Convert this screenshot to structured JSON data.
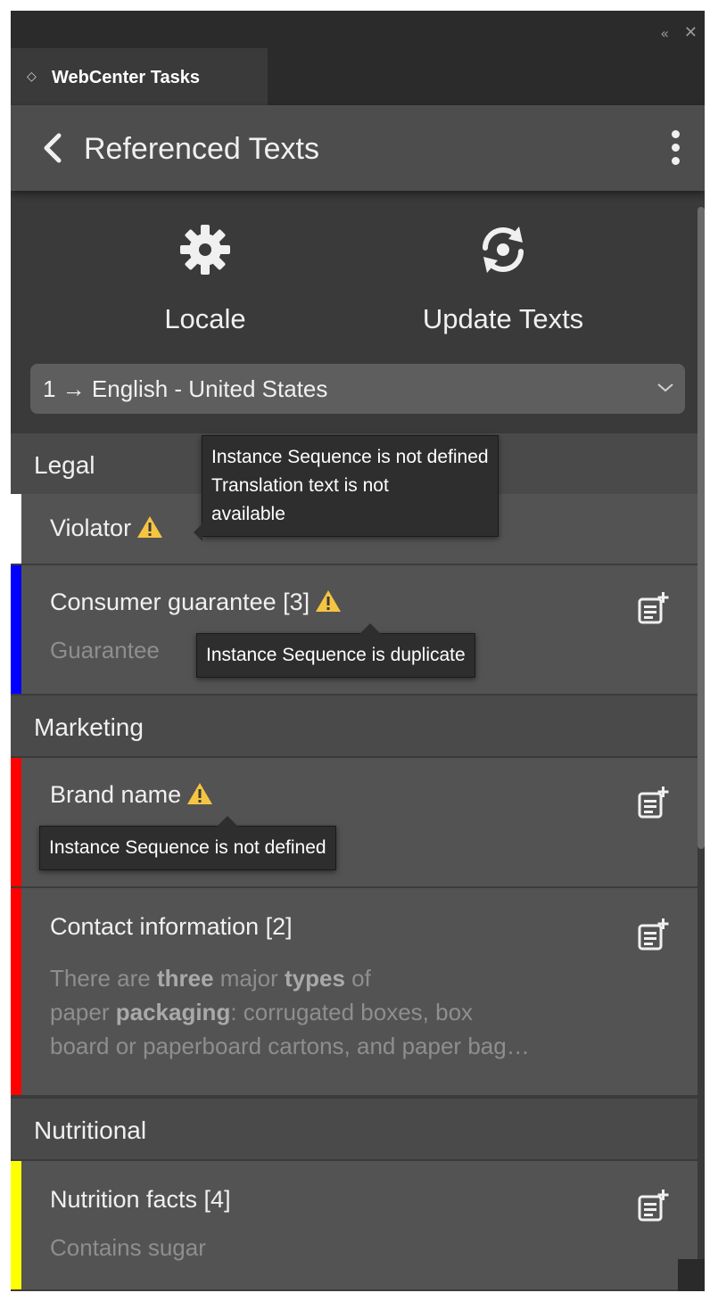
{
  "window": {
    "collapse_icon": "double-chevron-left-icon",
    "close_icon": "close-icon"
  },
  "tab": {
    "label": "WebCenter Tasks",
    "icon": "diamond-outline-icon"
  },
  "header": {
    "title": "Referenced Texts",
    "back_icon": "chevron-left-icon",
    "menu_icon": "kebab-menu-icon"
  },
  "actions": [
    {
      "label": "Locale",
      "icon": "gear-icon"
    },
    {
      "label": "Update Texts",
      "icon": "sync-icon"
    }
  ],
  "locale_select": {
    "value": "1 → English - United States",
    "icon": "chevron-down-icon"
  },
  "sections": [
    {
      "label": "Legal"
    },
    {
      "label": "Marketing"
    },
    {
      "label": "Nutritional"
    }
  ],
  "items": [
    {
      "title": "Violator",
      "color": "#ffffff",
      "warning": true,
      "tooltip": [
        "Instance Sequence is not defined",
        "Translation text is not",
        "available"
      ]
    },
    {
      "title": "Consumer guarantee [3]",
      "color": "#0000ff",
      "subtitle": "Guarantee",
      "warning": true,
      "tooltip": [
        "Instance Sequence is duplicate"
      ]
    },
    {
      "title": "Brand name",
      "color": "#ff0000",
      "warning": true,
      "tooltip": [
        "Instance Sequence is not defined"
      ]
    },
    {
      "title": "Contact information [2]",
      "color": "#ff0000",
      "body": {
        "p1": "There are ",
        "b1": "three",
        "p2": " major ",
        "b2": "types",
        "p3": " of",
        "p4": "paper ",
        "b3": "packaging",
        "p5": ": corrugated boxes, box",
        "p6": "board or paperboard cartons, and paper bag…"
      }
    },
    {
      "title": "Nutrition facts [4]",
      "color": "#ffff00",
      "subtitle": "Contains sugar"
    }
  ],
  "colors": {
    "warning": "#f5c542",
    "panel": "#3a3a3a",
    "item": "#535353"
  }
}
